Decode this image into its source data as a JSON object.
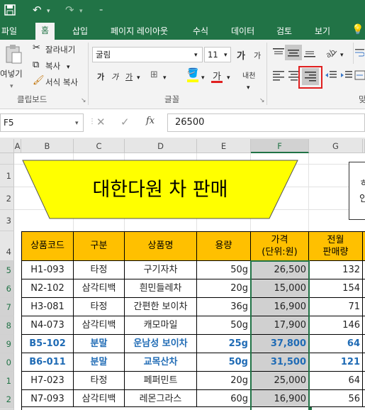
{
  "quick_access": {
    "save_icon": "save-icon",
    "undo_icon": "undo-icon",
    "redo_icon": "redo-icon",
    "customize_icon": "customize-icon"
  },
  "tabs": [
    "파일",
    "홈",
    "삽입",
    "페이지 레이아웃",
    "수식",
    "데이터",
    "검토",
    "보기"
  ],
  "active_tab": "홈",
  "ribbon": {
    "clipboard": {
      "paste_label": "여넣기",
      "cut_label": "잘라내기",
      "copy_label": "복사",
      "format_painter_label": "서식 복사",
      "group_name": "클립보드"
    },
    "font": {
      "font_name": "굴림",
      "font_size": "11",
      "increase_label": "가",
      "decrease_label": "가",
      "bold": "가",
      "italic": "가",
      "underline": "가",
      "font_color_label": "가",
      "phonetic_label": "내천",
      "group_name": "글꼴"
    },
    "alignment": {
      "group_name": "맞"
    }
  },
  "name_box": "F5",
  "formula_value": "26500",
  "fx_label": "fx",
  "columns": [
    "A",
    "B",
    "C",
    "D",
    "E",
    "F",
    "G"
  ],
  "rows": [
    "1",
    "2",
    "3",
    "4",
    "5",
    "6",
    "7",
    "8",
    "9",
    "0",
    "1",
    "2"
  ],
  "title_banner": "대한다원 차 판매",
  "side_note": [
    "ㅎ",
    "인"
  ],
  "table_headers": [
    "상품코드",
    "구분",
    "상품명",
    "용량",
    "가격\n(단위:원)",
    "전월\n판매량"
  ],
  "table_rows": [
    {
      "code": "H1-093",
      "type": "타정",
      "name": "구기자차",
      "size": "50g",
      "price": "26,500",
      "sales": "132",
      "bold": false
    },
    {
      "code": "N2-102",
      "type": "삼각티백",
      "name": "흰민들레차",
      "size": "20g",
      "price": "15,000",
      "sales": "154",
      "bold": false
    },
    {
      "code": "H3-081",
      "type": "타정",
      "name": "간편한 보이차",
      "size": "36g",
      "price": "16,900",
      "sales": "71",
      "bold": false
    },
    {
      "code": "N4-073",
      "type": "삼각티백",
      "name": "캐모마일",
      "size": "50g",
      "price": "17,900",
      "sales": "146",
      "bold": false
    },
    {
      "code": "B5-102",
      "type": "분말",
      "name": "운남성 보이차",
      "size": "25g",
      "price": "37,800",
      "sales": "64",
      "bold": true
    },
    {
      "code": "B6-011",
      "type": "분말",
      "name": "교목산차",
      "size": "50g",
      "price": "31,500",
      "sales": "121",
      "bold": true
    },
    {
      "code": "H7-023",
      "type": "타정",
      "name": "페퍼민트",
      "size": "20g",
      "price": "25,000",
      "sales": "64",
      "bold": false
    },
    {
      "code": "N7-093",
      "type": "삼각티백",
      "name": "레몬그라스",
      "size": "60g",
      "price": "16,900",
      "sales": "56",
      "bold": false
    }
  ],
  "colors": {
    "excel_green": "#217346",
    "header_fill": "#ffc000",
    "banner_fill": "#ffff00",
    "selection_gray": "#d0d0d0",
    "bold_blue": "#1f6bb5",
    "highlight_red": "#e02020"
  }
}
